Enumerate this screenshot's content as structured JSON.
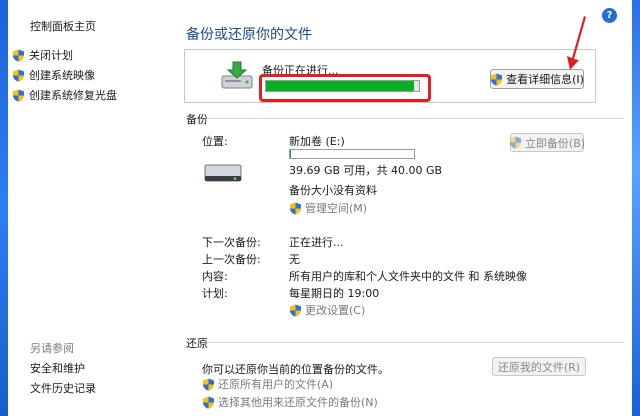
{
  "sidebar": {
    "home_label": "控制面板主页",
    "items": [
      {
        "label": "关闭计划",
        "icon": "uac-shield-icon"
      },
      {
        "label": "创建系统映像",
        "icon": "uac-shield-icon"
      },
      {
        "label": "创建系统修复光盘",
        "icon": "uac-shield-icon"
      }
    ],
    "see_also_title": "另请参阅",
    "see_also": [
      "安全和维护",
      "文件历史记录"
    ]
  },
  "header": {
    "title": "备份或还原你的文件",
    "help_icon": "help-icon",
    "help_glyph": "?"
  },
  "status": {
    "text": "备份正在进行...",
    "progress_fraction": 0.97,
    "details_button": "查看详细信息(I)",
    "annotation_color": "#e02020"
  },
  "backup": {
    "section_title": "备份",
    "location_label": "位置:",
    "location_value": "新加卷 (E:)",
    "disk_used_fraction": 0.008,
    "free_space": "39.69 GB 可用，共 40.00 GB",
    "backup_size": "备份大小没有资料",
    "manage_space": "管理空间(M)",
    "backup_now": "立即备份(B)",
    "next_backup_label": "下一次备份:",
    "next_backup_value": "正在进行...",
    "last_backup_label": "上一次备份:",
    "last_backup_value": "无",
    "contents_label": "内容:",
    "contents_value": "所有用户的库和个人文件夹中的文件 和 系统映像",
    "schedule_label": "计划:",
    "schedule_value": "每星期日的 19:00",
    "change_settings": "更改设置(C)"
  },
  "restore": {
    "section_title": "还原",
    "description": "你可以还原你当前的位置备份的文件。",
    "restore_my_files": "还原我的文件(R)",
    "restore_all_users": "还原所有用户的文件(A)",
    "select_other_backup": "选择其他用来还原文件的备份(N)"
  },
  "colors": {
    "title_blue": "#1d4a8c",
    "progress_green": "#06b025",
    "accent_blue": "#1f6fd1"
  }
}
